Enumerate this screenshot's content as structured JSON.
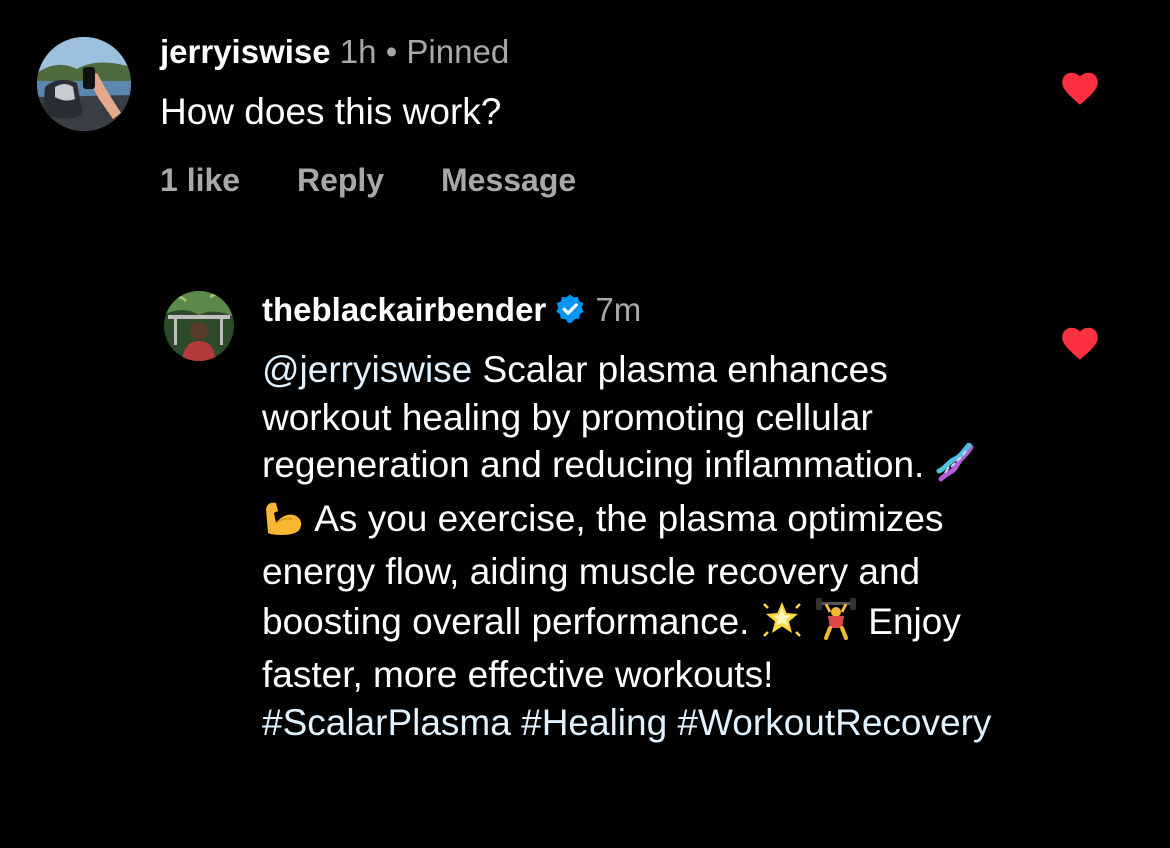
{
  "comments": [
    {
      "username": "jerryiswise",
      "time": "1h",
      "separator": "•",
      "pinned": "Pinned",
      "text": "How does this work?",
      "likes": "1 like",
      "reply": "Reply",
      "message": "Message",
      "liked_color": "#ff3040"
    }
  ],
  "reply": {
    "username": "theblackairbender",
    "verified_icon": "verified-badge-icon",
    "time": "7m",
    "mention": "@jerryiswise",
    "text_1": " Scalar plasma enhances workout healing by promoting cellular regeneration and reducing inflammation. ",
    "emoji_1": "dna-icon",
    "emoji_2": "flexed-biceps-icon",
    "text_2": " As you exercise, the plasma optimizes energy flow, aiding muscle recovery and boosting overall performance. ",
    "emoji_3": "glowing-star-icon",
    "emoji_4": "weightlifter-icon",
    "text_3": " Enjoy faster, more effective workouts! ",
    "hashtags": [
      "#ScalarPlasma",
      "#Healing",
      "#WorkoutRecovery"
    ],
    "liked_color": "#ff3040",
    "link_color": "#e0f1ff",
    "verified_color": "#0095f6"
  }
}
